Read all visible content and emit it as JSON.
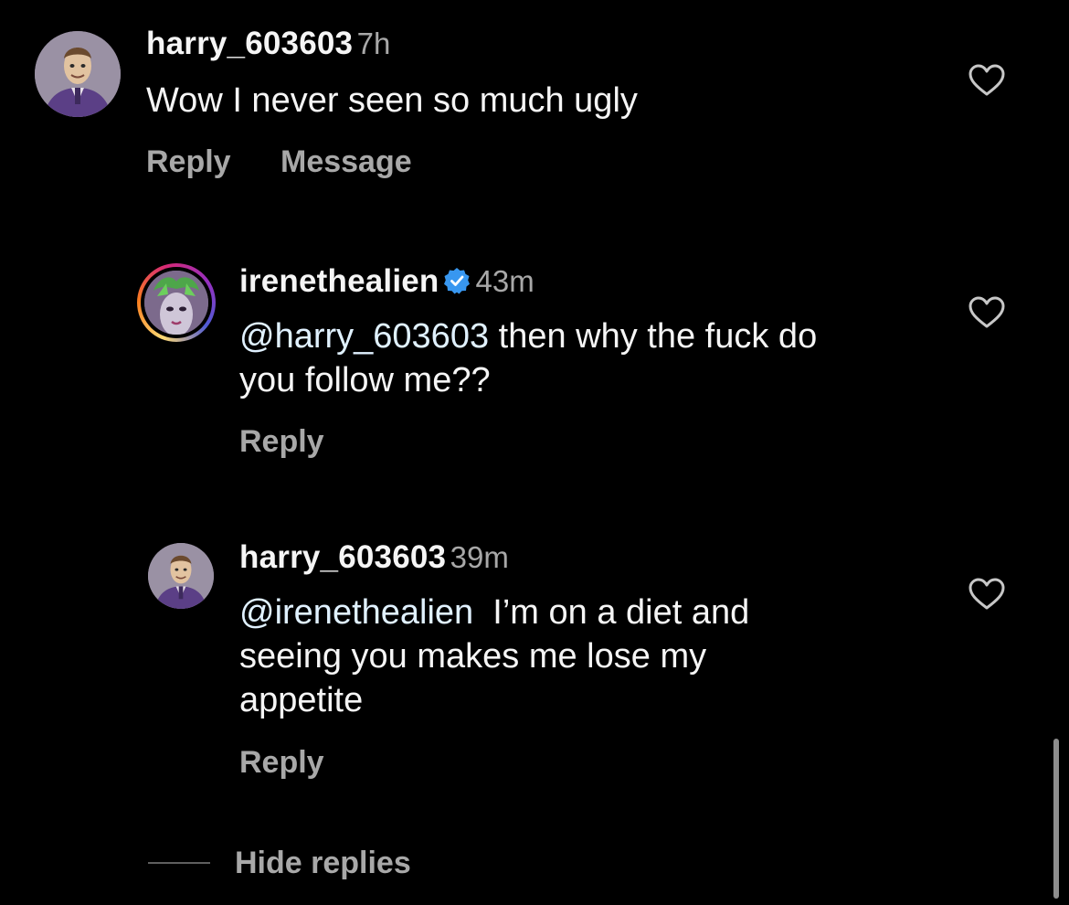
{
  "comments": [
    {
      "username": "harry_603603",
      "time": "7h",
      "text": "Wow I never seen so much ugly",
      "actions": {
        "reply": "Reply",
        "message": "Message"
      },
      "avatar_icon": "toy-cowboy-avatar"
    }
  ],
  "replies": [
    {
      "username": "irenethealien",
      "verified": true,
      "time": "43m",
      "mention": "@harry_603603",
      "text_line1": " then why the fuck do",
      "text_line2": "you follow me??",
      "reply_label": "Reply",
      "avatar_icon": "alien-avatar"
    },
    {
      "username": "harry_603603",
      "time": "39m",
      "mention": "@irenethealien",
      "text_line1": "  I’m on a diet and",
      "text_line2": "seeing you makes me lose my",
      "text_line3": "appetite",
      "reply_label": "Reply",
      "avatar_icon": "toy-cowboy-avatar"
    }
  ],
  "hide_replies_label": "Hide replies",
  "colors": {
    "background": "#000000",
    "primary_text": "#f5f5f5",
    "secondary_text": "#a8a8a8",
    "verified_blue": "#3897f0"
  },
  "icons": [
    "heart-icon",
    "verified-badge-icon"
  ]
}
